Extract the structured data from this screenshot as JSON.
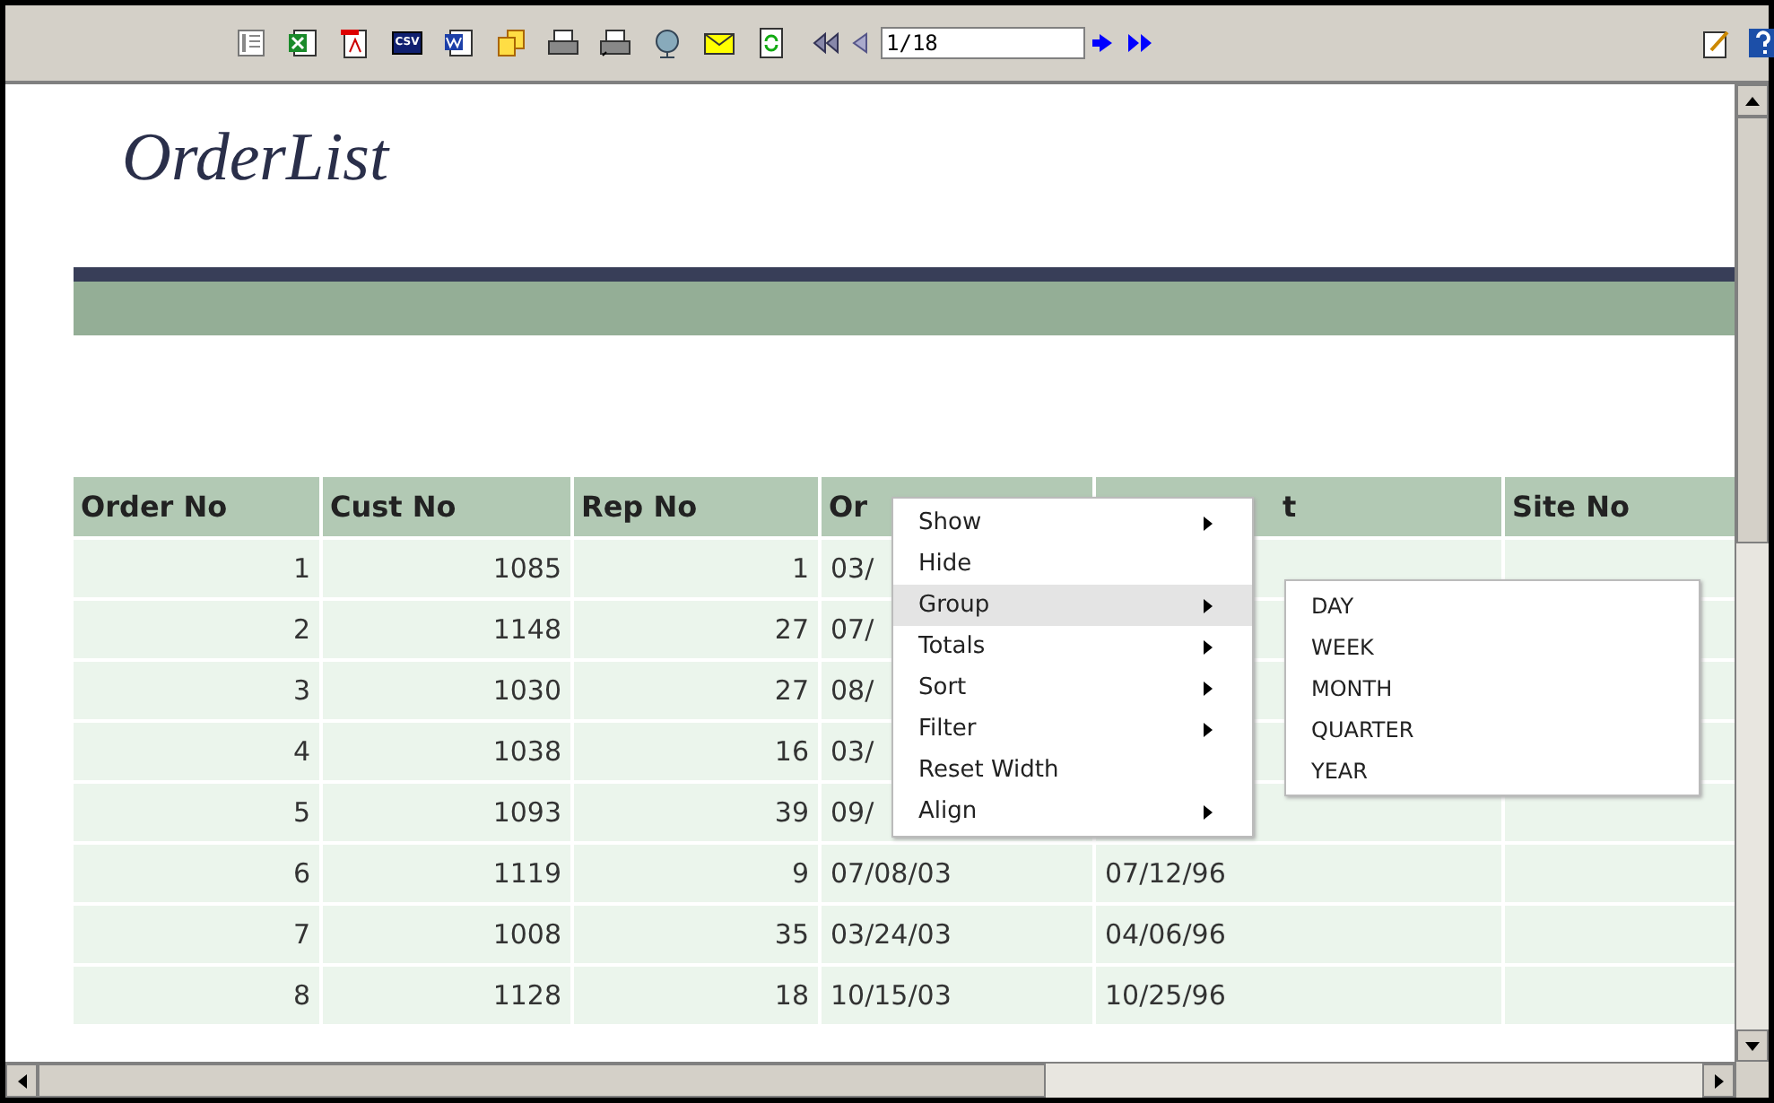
{
  "toolbar": {
    "csv_label": "CSV",
    "page_field": "1/18"
  },
  "report": {
    "title": "OrderList"
  },
  "table": {
    "columns": [
      "Order No",
      "Cust No",
      "Rep No",
      "Or",
      "t",
      "Site No"
    ],
    "rows": [
      [
        "1",
        "1085",
        "1",
        "03/",
        ""
      ],
      [
        "2",
        "1148",
        "27",
        "07/",
        ""
      ],
      [
        "3",
        "1030",
        "27",
        "08/",
        ""
      ],
      [
        "4",
        "1038",
        "16",
        "03/",
        ""
      ],
      [
        "5",
        "1093",
        "39",
        "09/",
        ""
      ],
      [
        "6",
        "1119",
        "9",
        "07/08/03",
        "07/12/96"
      ],
      [
        "7",
        "1008",
        "35",
        "03/24/03",
        "04/06/96"
      ],
      [
        "8",
        "1128",
        "18",
        "10/15/03",
        "10/25/96"
      ]
    ]
  },
  "context_menu": {
    "items": [
      {
        "label": "Show",
        "submenu": true,
        "selected": false
      },
      {
        "label": "Hide",
        "submenu": false,
        "selected": false
      },
      {
        "label": "Group",
        "submenu": true,
        "selected": true
      },
      {
        "label": "Totals",
        "submenu": true,
        "selected": false
      },
      {
        "label": "Sort",
        "submenu": true,
        "selected": false
      },
      {
        "label": "Filter",
        "submenu": true,
        "selected": false
      },
      {
        "label": "Reset Width",
        "submenu": false,
        "selected": false
      },
      {
        "label": "Align",
        "submenu": true,
        "selected": false
      }
    ],
    "submenu": [
      "DAY",
      "WEEK",
      "MONTH",
      "QUARTER",
      "YEAR"
    ]
  }
}
